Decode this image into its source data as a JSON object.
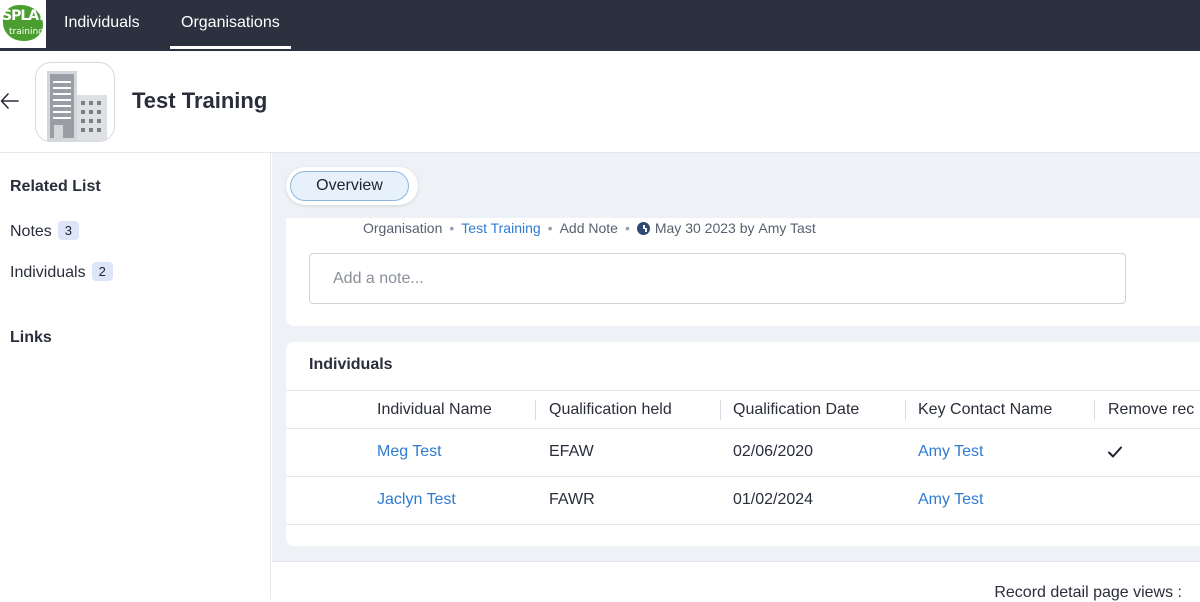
{
  "brand": {
    "logo_text": "SPLAT",
    "logo_sub": "training"
  },
  "topnav": {
    "tabs": [
      {
        "label": "Individuals"
      },
      {
        "label": "Organisations",
        "active": true
      }
    ]
  },
  "record": {
    "title": "Test Training",
    "avatar_icon": "building-icon"
  },
  "sidebar": {
    "related_list_heading": "Related List",
    "items": [
      {
        "label": "Notes",
        "count": "3"
      },
      {
        "label": "Individuals",
        "count": "2"
      }
    ],
    "links_heading": "Links"
  },
  "tabs": {
    "overview": "Overview"
  },
  "notes": {
    "meta": {
      "module": "Organisation",
      "record": "Test Training",
      "action": "Add Note",
      "date": "May 30 2023",
      "by": "by",
      "author": "Amy Tast"
    },
    "input_placeholder": "Add a note..."
  },
  "individuals": {
    "title": "Individuals",
    "columns": [
      "Individual Name",
      "Qualification held",
      "Qualification Date",
      "Key Contact Name",
      "Remove record"
    ],
    "rows": [
      {
        "name": "Meg Test",
        "qualification": "EFAW",
        "date": "02/06/2020",
        "contact": "Amy Test",
        "remove": true
      },
      {
        "name": "Jaclyn Test",
        "qualification": "FAWR",
        "date": "01/02/2024",
        "contact": "Amy Test",
        "remove": false
      }
    ]
  },
  "footer": {
    "views_label": "Record detail page views :"
  },
  "colors": {
    "nav_bg": "#2c3140",
    "link": "#2f7bd2",
    "page_bg": "#eef1f5",
    "brand_green": "#4a9e2f"
  }
}
